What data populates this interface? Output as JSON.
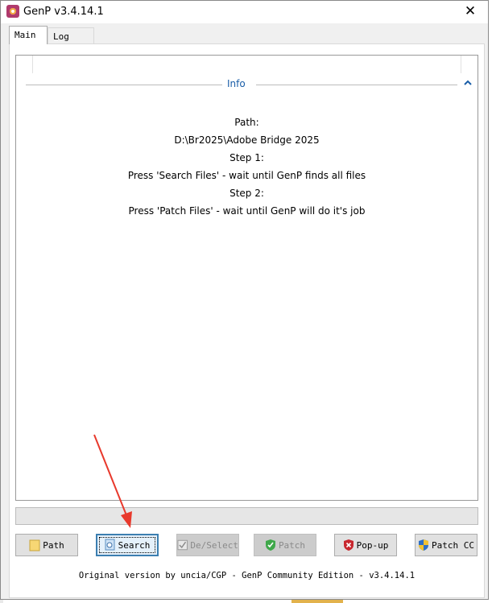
{
  "window": {
    "title": "GenP v3.4.14.1",
    "close_glyph": "✕"
  },
  "tabs": [
    {
      "label": "Main",
      "selected": true
    },
    {
      "label": "Log",
      "selected": false
    }
  ],
  "info": {
    "section_title": "Info",
    "lines": [
      "Path:",
      "D:\\Br2025\\Adobe Bridge 2025",
      "Step 1:",
      "Press 'Search Files' - wait until GenP finds all files",
      "Step 2:",
      "Press 'Patch Files' - wait until GenP will do it's job"
    ]
  },
  "progress": {
    "value": 0
  },
  "buttons": [
    {
      "label": "Path",
      "icon": "folder-icon",
      "enabled": true
    },
    {
      "label": "Search",
      "icon": "search-file-icon",
      "enabled": true,
      "focused": true
    },
    {
      "label": "De/Select",
      "icon": "checklist-icon",
      "enabled": false
    },
    {
      "label": "Patch",
      "icon": "shield-check-icon",
      "enabled": false
    },
    {
      "label": "Pop-up",
      "icon": "shield-x-icon",
      "enabled": true
    },
    {
      "label": "Patch CC",
      "icon": "uac-shield-icon",
      "enabled": true
    }
  ],
  "footer": "Original version by uncia/CGP - GenP Community Edition - v3.4.14.1",
  "colors": {
    "info_title": "#1a5ea8",
    "annotation_arrow": "#e8392c",
    "focus_border": "#3c7fb1"
  }
}
